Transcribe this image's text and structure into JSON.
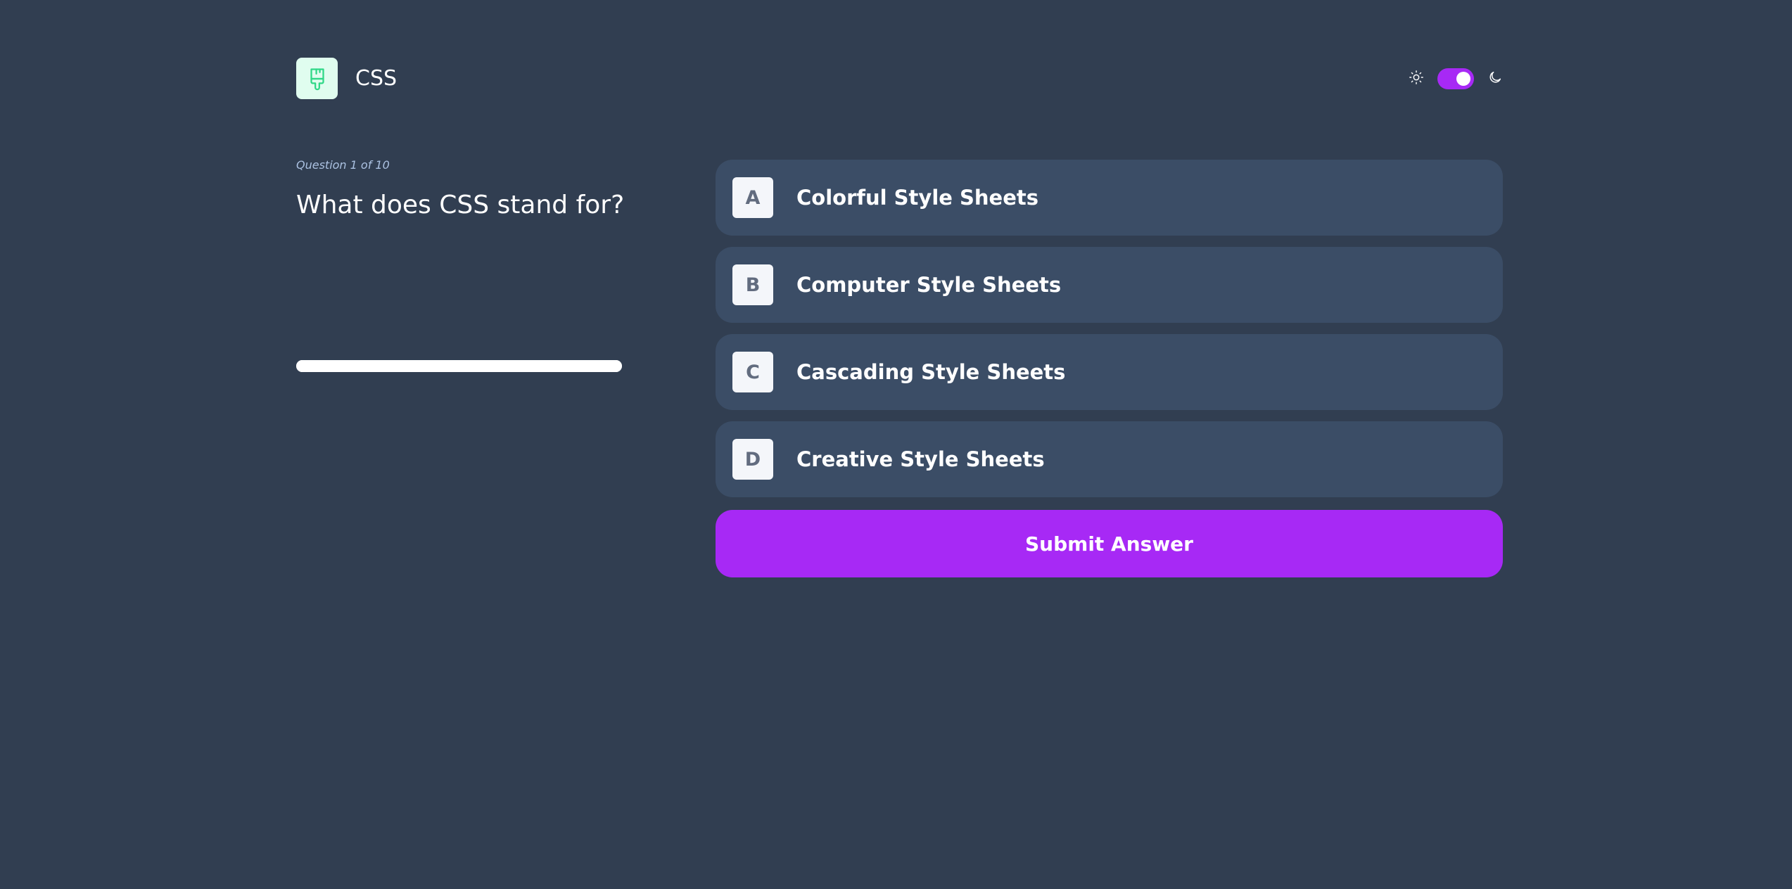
{
  "header": {
    "subject_title": "CSS",
    "subject_icon": "paintbrush-icon",
    "theme": {
      "light_icon": "sun-icon",
      "dark_icon": "moon-icon",
      "dark_mode_enabled": true
    }
  },
  "question": {
    "counter": "Question 1 of 10",
    "text": "What does CSS stand for?",
    "progress": 1.0
  },
  "options": [
    {
      "letter": "A",
      "label": "Colorful Style Sheets"
    },
    {
      "letter": "B",
      "label": "Computer Style Sheets"
    },
    {
      "letter": "C",
      "label": "Cascading Style Sheets"
    },
    {
      "letter": "D",
      "label": "Creative Style Sheets"
    }
  ],
  "submit_label": "Submit Answer",
  "colors": {
    "background": "#313e51",
    "card": "#3b4d66",
    "accent": "#a729f5",
    "icon_bg": "#e0fdef",
    "icon_fg": "#2fd887"
  }
}
